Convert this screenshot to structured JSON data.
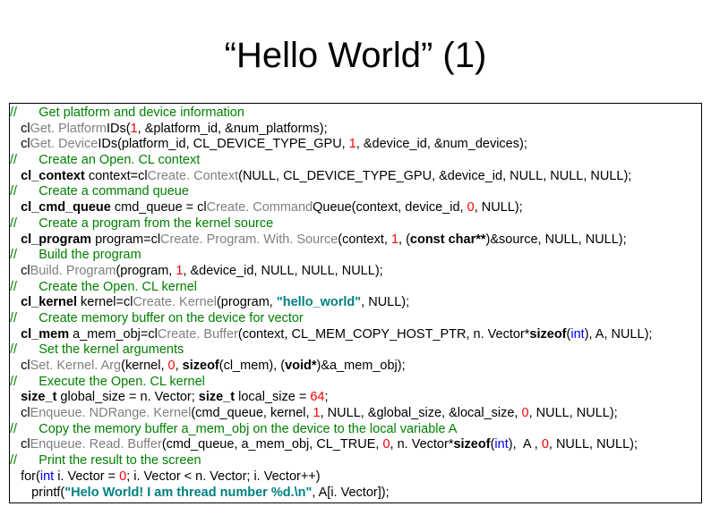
{
  "title": "“Hello World” (1)",
  "lines": [
    [
      {
        "cls": "c-green",
        "t": "//      Get platform and device information"
      }
    ],
    [
      {
        "cls": "",
        "t": "   cl"
      },
      {
        "cls": "c-gray",
        "t": "Get. Platform"
      },
      {
        "cls": "",
        "t": "IDs("
      },
      {
        "cls": "c-red",
        "t": "1"
      },
      {
        "cls": "",
        "t": ", &platform_id, &num_platforms);"
      }
    ],
    [
      {
        "cls": "",
        "t": "   cl"
      },
      {
        "cls": "c-gray",
        "t": "Get. Device"
      },
      {
        "cls": "",
        "t": "IDs(platform_id, CL_DEVICE_TYPE_GPU, "
      },
      {
        "cls": "c-red",
        "t": "1"
      },
      {
        "cls": "",
        "t": ", &device_id, &num_devices);"
      }
    ],
    [
      {
        "cls": "c-green",
        "t": "//      Create an Open. CL context"
      }
    ],
    [
      {
        "cls": "",
        "t": "   "
      },
      {
        "cls": "b",
        "t": "cl_context"
      },
      {
        "cls": "",
        "t": " context=cl"
      },
      {
        "cls": "c-gray",
        "t": "Create. Context"
      },
      {
        "cls": "",
        "t": "(NULL, CL_DEVICE_TYPE_GPU, &device_id, NULL, NULL, NULL);"
      }
    ],
    [
      {
        "cls": "c-green",
        "t": "//      Create a command queue"
      }
    ],
    [
      {
        "cls": "",
        "t": "   "
      },
      {
        "cls": "b",
        "t": "cl_cmd_queue"
      },
      {
        "cls": "",
        "t": " cmd_queue = cl"
      },
      {
        "cls": "c-gray",
        "t": "Create. Command"
      },
      {
        "cls": "",
        "t": "Queue(context, device_id, "
      },
      {
        "cls": "c-red",
        "t": "0"
      },
      {
        "cls": "",
        "t": ", NULL);"
      }
    ],
    [
      {
        "cls": "c-green",
        "t": "//      Create a program from the kernel source"
      }
    ],
    [
      {
        "cls": "",
        "t": "   "
      },
      {
        "cls": "b",
        "t": "cl_program"
      },
      {
        "cls": "",
        "t": " program=cl"
      },
      {
        "cls": "c-gray",
        "t": "Create. Program. With. Source"
      },
      {
        "cls": "",
        "t": "(context, "
      },
      {
        "cls": "c-red",
        "t": "1"
      },
      {
        "cls": "",
        "t": ", ("
      },
      {
        "cls": "b",
        "t": "const char**"
      },
      {
        "cls": "",
        "t": ")&source, NULL, NULL);"
      }
    ],
    [
      {
        "cls": "c-green",
        "t": "//      Build the program"
      }
    ],
    [
      {
        "cls": "",
        "t": "   cl"
      },
      {
        "cls": "c-gray",
        "t": "Build. Program"
      },
      {
        "cls": "",
        "t": "(program, "
      },
      {
        "cls": "c-red",
        "t": "1"
      },
      {
        "cls": "",
        "t": ", &device_id, NULL, NULL, NULL);"
      }
    ],
    [
      {
        "cls": "c-green",
        "t": "//      Create the Open. CL kernel"
      }
    ],
    [
      {
        "cls": "",
        "t": "   "
      },
      {
        "cls": "b",
        "t": "cl_kernel"
      },
      {
        "cls": "",
        "t": " kernel=cl"
      },
      {
        "cls": "c-gray",
        "t": "Create. Kernel"
      },
      {
        "cls": "",
        "t": "(program, "
      },
      {
        "cls": "c-teal b",
        "t": "\"hello_world\""
      },
      {
        "cls": "",
        "t": ", NULL);"
      }
    ],
    [
      {
        "cls": "c-green",
        "t": "//      Create memory buffer on the device for vector"
      }
    ],
    [
      {
        "cls": "",
        "t": "   "
      },
      {
        "cls": "b",
        "t": "cl_mem"
      },
      {
        "cls": "",
        "t": " a_mem_obj=cl"
      },
      {
        "cls": "c-gray",
        "t": "Create. Buffer"
      },
      {
        "cls": "",
        "t": "(context, CL_MEM_COPY_HOST_PTR, n. Vector*"
      },
      {
        "cls": "b",
        "t": "sizeof"
      },
      {
        "cls": "",
        "t": "("
      },
      {
        "cls": "c-blue",
        "t": "int"
      },
      {
        "cls": "",
        "t": "), A, NULL);"
      }
    ],
    [
      {
        "cls": "c-green",
        "t": "//      Set the kernel arguments"
      }
    ],
    [
      {
        "cls": "",
        "t": "   cl"
      },
      {
        "cls": "c-gray",
        "t": "Set. Kernel. Arg"
      },
      {
        "cls": "",
        "t": "(kernel, "
      },
      {
        "cls": "c-red",
        "t": "0"
      },
      {
        "cls": "",
        "t": ", "
      },
      {
        "cls": "b",
        "t": "sizeof"
      },
      {
        "cls": "",
        "t": "(cl_mem), ("
      },
      {
        "cls": "b",
        "t": "void*"
      },
      {
        "cls": "",
        "t": ")&a_mem_obj);"
      }
    ],
    [
      {
        "cls": "c-green",
        "t": "//      Execute the Open. CL kernel"
      }
    ],
    [
      {
        "cls": "",
        "t": "   "
      },
      {
        "cls": "b",
        "t": "size_t"
      },
      {
        "cls": "",
        "t": " global_size = n. Vector; "
      },
      {
        "cls": "b",
        "t": "size_t"
      },
      {
        "cls": "",
        "t": " local_size = "
      },
      {
        "cls": "c-red",
        "t": "64"
      },
      {
        "cls": "",
        "t": ";"
      }
    ],
    [
      {
        "cls": "",
        "t": "   cl"
      },
      {
        "cls": "c-gray",
        "t": "Enqueue. NDRange. Kernel"
      },
      {
        "cls": "",
        "t": "(cmd_queue, kernel, "
      },
      {
        "cls": "c-red",
        "t": "1"
      },
      {
        "cls": "",
        "t": ", NULL, &global_size, &local_size, "
      },
      {
        "cls": "c-red",
        "t": "0"
      },
      {
        "cls": "",
        "t": ", NULL, NULL);"
      }
    ],
    [
      {
        "cls": "c-green",
        "t": "//      Copy the memory buffer a_mem_obj on the device to the local variable A"
      }
    ],
    [
      {
        "cls": "",
        "t": "   cl"
      },
      {
        "cls": "c-gray",
        "t": "Enqueue. Read. Buffer"
      },
      {
        "cls": "",
        "t": "(cmd_queue, a_mem_obj, CL_TRUE, "
      },
      {
        "cls": "c-red",
        "t": "0"
      },
      {
        "cls": "",
        "t": ", n. Vector*"
      },
      {
        "cls": "b",
        "t": "sizeof"
      },
      {
        "cls": "",
        "t": "("
      },
      {
        "cls": "c-blue",
        "t": "int"
      },
      {
        "cls": "",
        "t": "),  A , "
      },
      {
        "cls": "c-red",
        "t": "0"
      },
      {
        "cls": "",
        "t": ", NULL, NULL);"
      }
    ],
    [
      {
        "cls": "c-green",
        "t": "//      Print the result to the screen"
      }
    ],
    [
      {
        "cls": "",
        "t": "   for("
      },
      {
        "cls": "c-blue",
        "t": "int"
      },
      {
        "cls": "",
        "t": " i. Vector = "
      },
      {
        "cls": "c-red",
        "t": "0"
      },
      {
        "cls": "",
        "t": "; i. Vector < n. Vector; i. Vector++)"
      }
    ],
    [
      {
        "cls": "",
        "t": "      printf("
      },
      {
        "cls": "c-teal b",
        "t": "\"Helo World! I am thread number %d.\\n\""
      },
      {
        "cls": "",
        "t": ", A[i. Vector]);"
      }
    ]
  ]
}
